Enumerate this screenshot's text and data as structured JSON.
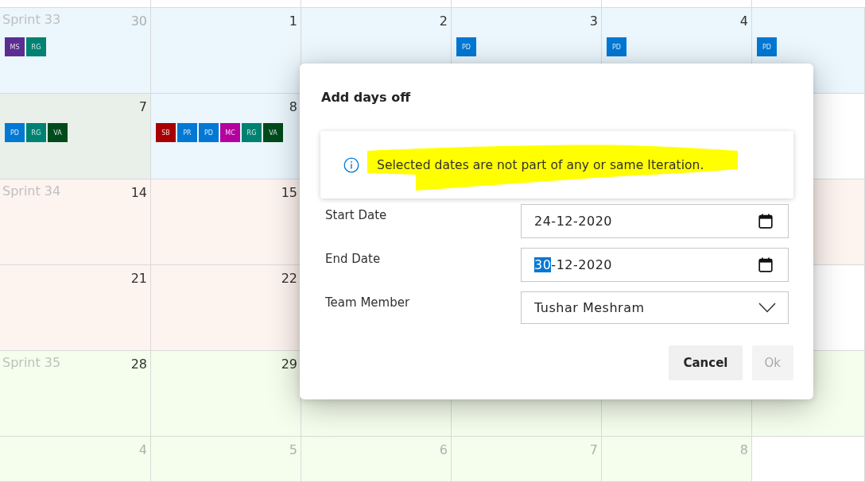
{
  "calendar": {
    "weeks": [
      {
        "sprint": "Sprint 33",
        "cells": [
          {
            "day": "30",
            "other_month": true,
            "color": "#ebf6fd",
            "badges": [
              {
                "initials": "MS",
                "color": "#5c2d91"
              },
              {
                "initials": "RG",
                "color": "#008272"
              }
            ]
          },
          {
            "day": "1",
            "other_month": false,
            "color": "#ebf6fd"
          },
          {
            "day": "2",
            "other_month": false,
            "color": "#ebf6fd"
          },
          {
            "day": "3",
            "other_month": false,
            "color": "#ebf6fd",
            "badges": [
              {
                "initials": "PD",
                "color": "#0078d4"
              }
            ]
          },
          {
            "day": "4",
            "other_month": false,
            "color": "#ebf6fd",
            "badges": [
              {
                "initials": "PD",
                "color": "#0078d4"
              }
            ]
          },
          {
            "color": "#ebf6fd",
            "badges": [
              {
                "initials": "PD",
                "color": "#0078d4"
              }
            ]
          }
        ]
      },
      {
        "cells": [
          {
            "day": "7",
            "other_month": false,
            "color": "#e8f0e9",
            "badges": [
              {
                "initials": "PD",
                "color": "#0078d4"
              },
              {
                "initials": "RG",
                "color": "#008272"
              },
              {
                "initials": "VA",
                "color": "#004b1c"
              }
            ]
          },
          {
            "day": "8",
            "other_month": false,
            "color": "#ebf6fd",
            "badges": [
              {
                "initials": "SB",
                "color": "#a80000"
              },
              {
                "initials": "PR",
                "color": "#0078d4"
              },
              {
                "initials": "PD",
                "color": "#0078d4"
              },
              {
                "initials": "MC",
                "color": "#b4009e"
              },
              {
                "initials": "RG",
                "color": "#008272"
              },
              {
                "initials": "VA",
                "color": "#004b1c"
              }
            ]
          },
          null,
          null,
          null,
          {
            "color": "#ffffff"
          }
        ]
      },
      {
        "sprint": "Sprint 34",
        "cells": [
          {
            "day": "14",
            "other_month": false,
            "color": "#fdf3ef"
          },
          {
            "day": "15",
            "other_month": false,
            "color": "#fdf3ef"
          },
          null,
          null,
          null,
          {
            "color": "#fdf3ef"
          }
        ]
      },
      {
        "cells": [
          {
            "day": "21",
            "other_month": false,
            "color": "#fdf3ef"
          },
          {
            "day": "22",
            "other_month": false,
            "color": "#fdf3ef"
          },
          null,
          null,
          null,
          {
            "color": "#ffffff"
          }
        ]
      },
      {
        "sprint": "Sprint 35",
        "cells": [
          {
            "day": "28",
            "other_month": false,
            "color": "#f5fdec"
          },
          {
            "day": "29",
            "other_month": false,
            "color": "#f5fdec"
          },
          {
            "color": "#f5fdec"
          },
          {
            "color": "#f5fdec"
          },
          {
            "color": "#f5fdec"
          },
          {
            "color": "#f5fdec"
          }
        ]
      },
      {
        "cells": [
          {
            "day": "4",
            "other_month": true,
            "color": "#f5fdec"
          },
          {
            "day": "5",
            "other_month": true,
            "color": "#f5fdec"
          },
          {
            "day": "6",
            "other_month": true,
            "color": "#f5fdec"
          },
          {
            "day": "7",
            "other_month": true,
            "color": "#f5fdec"
          },
          {
            "day": "8",
            "other_month": true,
            "color": "#f5fdec"
          },
          {
            "color": "#ffffff"
          }
        ]
      }
    ]
  },
  "dialog": {
    "title": "Add days off",
    "message": {
      "kind": "info",
      "text": "Selected dates are not part of any or same Iteration.",
      "highlighted": true
    },
    "fields": [
      {
        "label": "Start Date",
        "kind": "date",
        "value_parts": [
          {
            "text": "24",
            "selected": false
          },
          {
            "text": "-12-2020",
            "selected": false
          }
        ]
      },
      {
        "label": "End Date",
        "kind": "date",
        "value_parts": [
          {
            "text": "30",
            "selected": true
          },
          {
            "text": "-12-2020",
            "selected": false
          }
        ]
      },
      {
        "label": "Team Member",
        "kind": "select",
        "value": "Tushar Meshram"
      }
    ],
    "buttons": [
      {
        "label": "Cancel",
        "disabled": false
      },
      {
        "label": "Ok",
        "disabled": true
      }
    ]
  }
}
